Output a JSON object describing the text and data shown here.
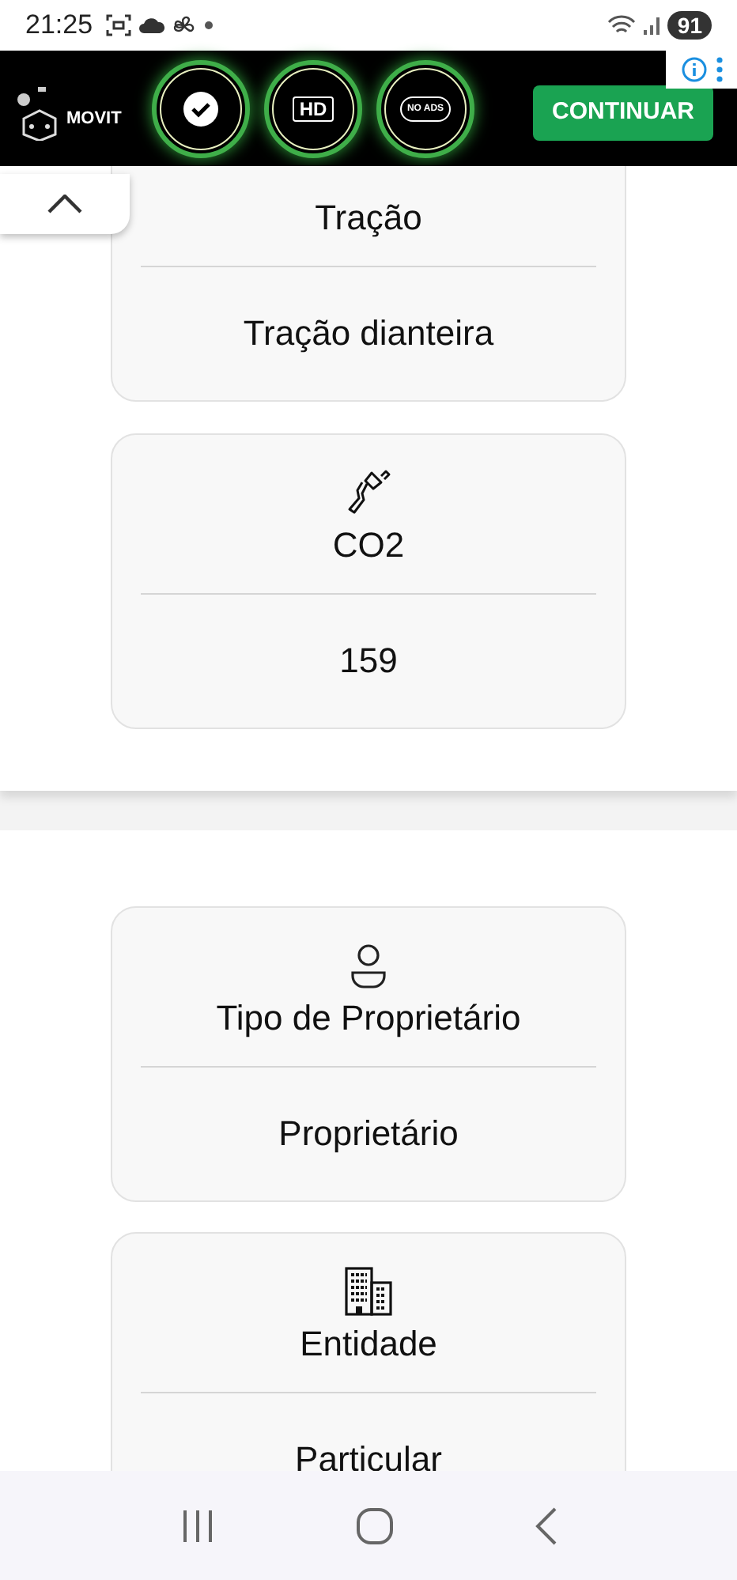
{
  "status_bar": {
    "time": "21:25",
    "battery": "91"
  },
  "ad": {
    "brand": "MOVIT",
    "badges": [
      {
        "kind": "check"
      },
      {
        "kind": "text",
        "label": "HD"
      },
      {
        "kind": "text",
        "label": "NO ADS"
      }
    ],
    "button": "CONTINUAR"
  },
  "sections": [
    {
      "cards": [
        {
          "label": "Tração",
          "value": "Tração dianteira"
        },
        {
          "kind": "exhaust",
          "label": "CO2",
          "value": "159"
        }
      ]
    },
    {
      "cards": [
        {
          "kind": "person",
          "label": "Tipo de Proprietário",
          "value": "Proprietário"
        },
        {
          "kind": "building",
          "label": "Entidade",
          "value": "Particular"
        }
      ]
    }
  ]
}
